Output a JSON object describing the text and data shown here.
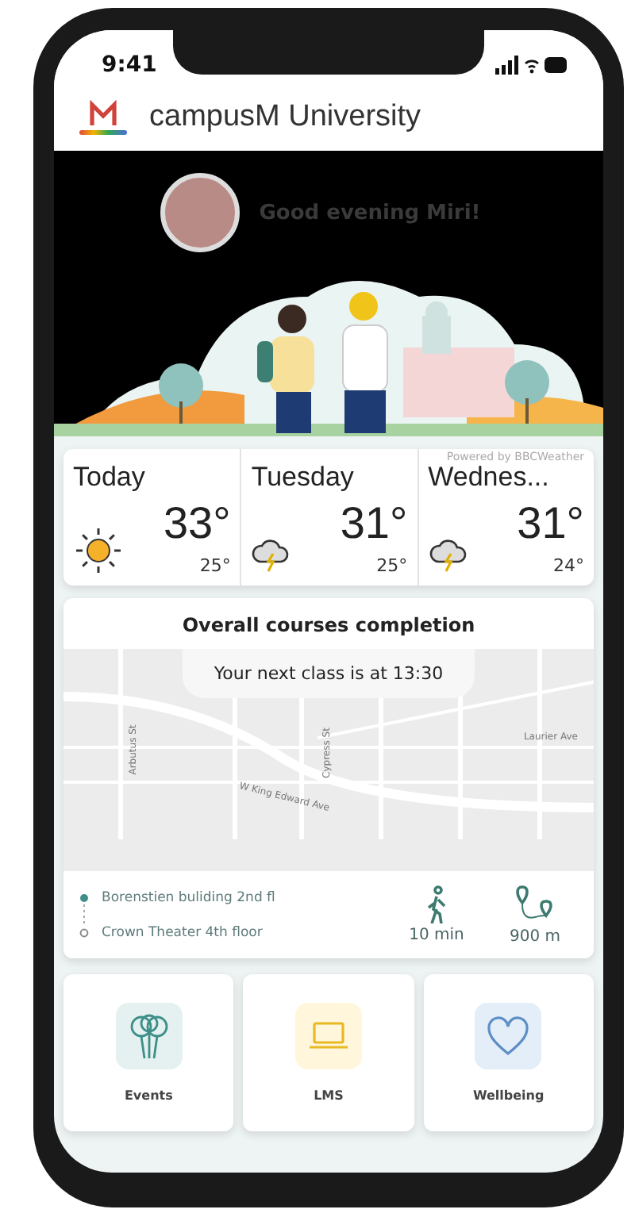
{
  "status_bar": {
    "time": "9:41"
  },
  "header": {
    "title": "campusM University"
  },
  "greeting": "Good evening Miri!",
  "weather": {
    "credit": "Powered by BBCWeather",
    "days": [
      {
        "day": "Today",
        "high": "33°",
        "low": "25°",
        "kind": "sun"
      },
      {
        "day": "Tuesday",
        "high": "31°",
        "low": "25°",
        "kind": "storm"
      },
      {
        "day": "Wednes...",
        "high": "31°",
        "low": "24°",
        "kind": "storm"
      }
    ]
  },
  "course_card": {
    "title": "Overall courses completion",
    "next_class": "Your next class is at 13:30",
    "map_labels": [
      {
        "text": "Arbutus St",
        "kind": "vertical"
      },
      {
        "text": "Cypress St",
        "kind": "vertical"
      },
      {
        "text": "Laurier Ave",
        "kind": "flat"
      },
      {
        "text": "W King Edward Ave",
        "kind": "slanted"
      }
    ],
    "route": {
      "from": "Borenstien buliding 2nd fl",
      "to": "Crown Theater 4th floor",
      "walk_time": "10 min",
      "distance": "900 m"
    }
  },
  "tiles": [
    {
      "label": "Events",
      "kind": "balloons",
      "color": "#e4f1f0"
    },
    {
      "label": "LMS",
      "kind": "laptop",
      "color": "#fff6dc"
    },
    {
      "label": "Wellbeing",
      "kind": "heart",
      "color": "#e3eef9"
    }
  ]
}
